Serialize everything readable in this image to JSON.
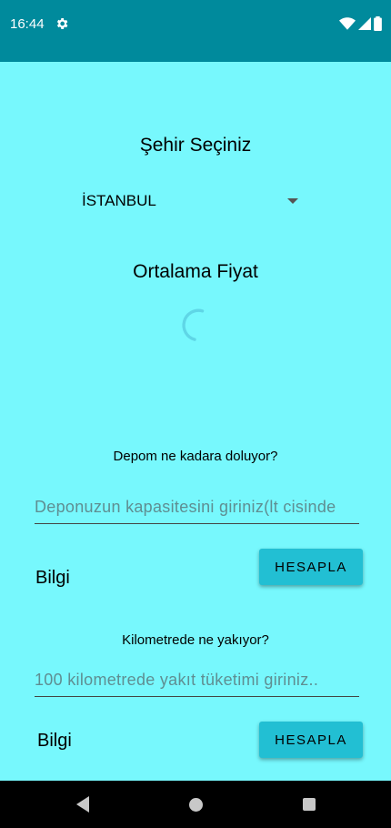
{
  "status_bar": {
    "time": "16:44"
  },
  "city": {
    "heading": "Şehir Seçiniz",
    "selected": "İSTANBUL"
  },
  "price": {
    "heading": "Ortalama Fiyat"
  },
  "tank": {
    "question": "Depom ne kadara doluyor?",
    "placeholder": "Deponuzun kapasitesini giriniz(lt cisinde",
    "info": "Bilgi",
    "button": "HESAPLA"
  },
  "consumption": {
    "question": "Kilometrede ne yakıyor?",
    "placeholder": "100 kilometrede yakıt tüketimi giriniz..",
    "info": "Bilgi",
    "button": "HESAPLA"
  },
  "colors": {
    "background": "#77f8fd",
    "status_bar": "#008a9c",
    "button": "#22bfd3"
  }
}
